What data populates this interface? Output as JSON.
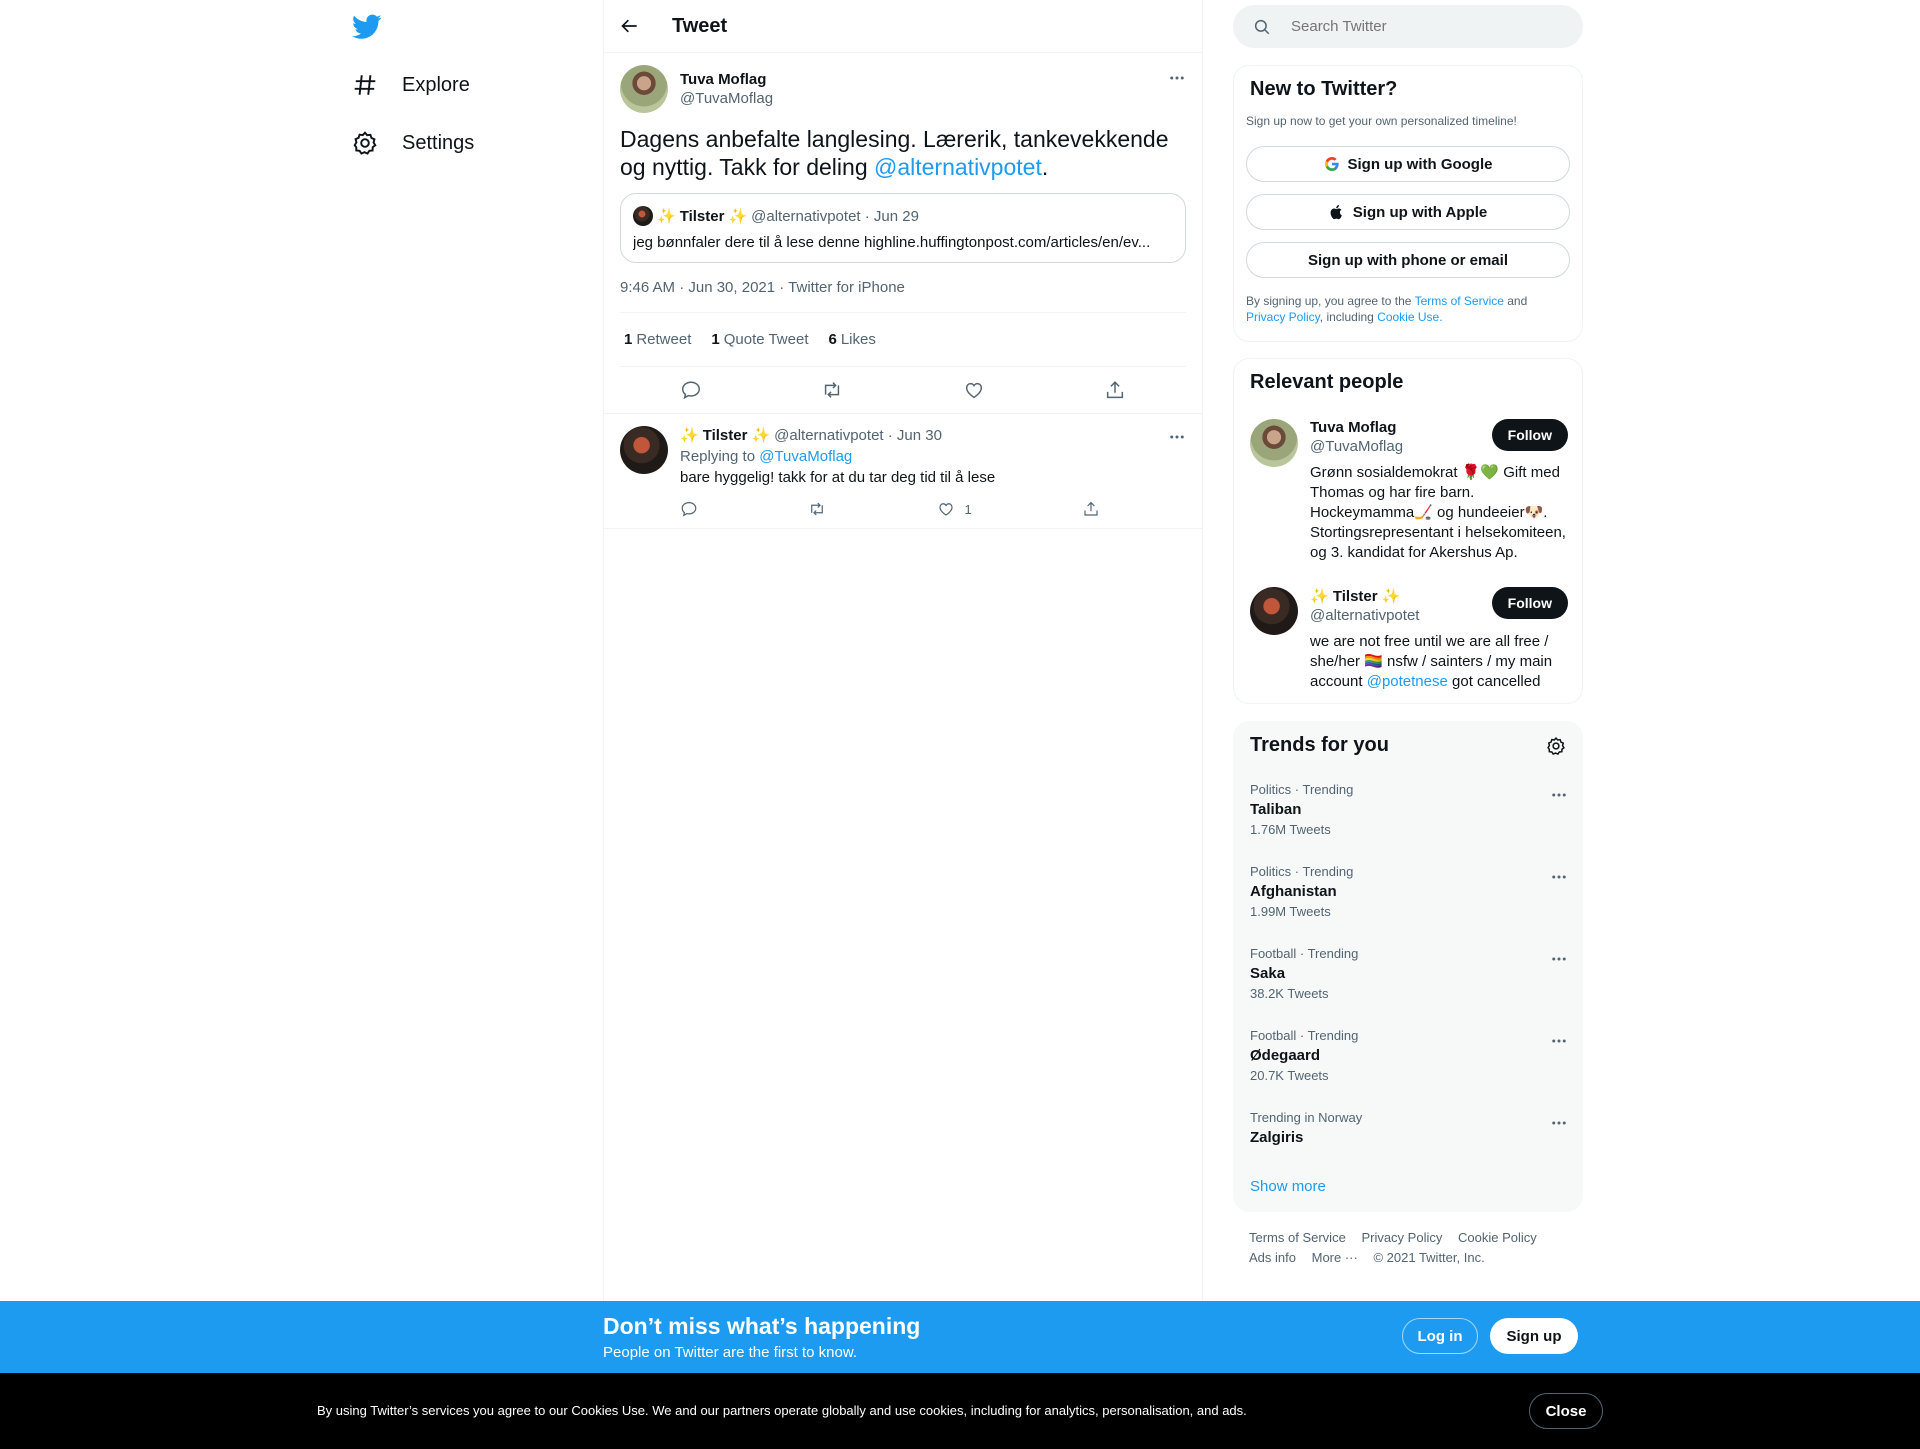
{
  "nav": {
    "explore_label": "Explore",
    "settings_label": "Settings"
  },
  "header": {
    "title": "Tweet"
  },
  "tweet": {
    "author_name": "Tuva Moflag",
    "author_handle": "@TuvaMoflag",
    "text_before": "Dagens anbefalte langlesing. Lærerik, tankevekkende og nyttig. Takk for deling ",
    "mention": "@alternativpotet",
    "text_after": ".",
    "quote": {
      "name_prefix": "✨",
      "name": "Tilster",
      "name_suffix": "✨",
      "handle_date": "@alternativpotet · Jun 29",
      "text": "jeg bønnfaler dere til å lese denne highline.huffingtonpost.com/articles/en/ev..."
    },
    "meta": "9:46 AM · Jun 30, 2021 · Twitter for iPhone",
    "stats": {
      "retweets": "1",
      "retweets_label": "Retweet",
      "quotes": "1",
      "quotes_label": "Quote Tweet",
      "likes": "6",
      "likes_label": "Likes"
    }
  },
  "reply": {
    "name_prefix": "✨",
    "name": "Tilster",
    "name_suffix": "✨",
    "handle_date": "@alternativpotet · Jun 30",
    "replying_label": "Replying to",
    "replying_to": "@TuvaMoflag",
    "text": "bare hyggelig! takk for at du tar deg tid til å lese",
    "like_count": "1"
  },
  "search": {
    "placeholder": "Search Twitter"
  },
  "new_to_twitter": {
    "title": "New to Twitter?",
    "subtitle": "Sign up now to get your own personalized timeline!",
    "google": "Sign up with Google",
    "apple": "Sign up with Apple",
    "phone": "Sign up with phone or email",
    "legal_1": "By signing up, you agree to the ",
    "tos": "Terms of Service",
    "legal_2": " and ",
    "privacy": "Privacy Policy",
    "legal_3": ", including ",
    "cookie": "Cookie Use."
  },
  "relevant": {
    "title": "Relevant people",
    "people": [
      {
        "name": "Tuva Moflag",
        "handle": "@TuvaMoflag",
        "bio": "Grønn sosialdemokrat 🌹💚 Gift med Thomas og har fire barn. Hockeymamma🏒 og hundeeier🐶. Stortingsrepresentant i helsekomiteen, og 3. kandidat for Akershus Ap.",
        "follow": "Follow"
      },
      {
        "name": "✨ Tilster ✨",
        "handle": "@alternativpotet",
        "bio_before": "we are not free until we are all free / she/her 🏳️‍🌈 nsfw / sainters / my main account ",
        "bio_mention": "@potetnese",
        "bio_after": " got cancelled",
        "follow": "Follow"
      }
    ]
  },
  "trends": {
    "title": "Trends for you",
    "items": [
      {
        "category": "Politics · Trending",
        "name": "Taliban",
        "count": "1.76M Tweets"
      },
      {
        "category": "Politics · Trending",
        "name": "Afghanistan",
        "count": "1.99M Tweets"
      },
      {
        "category": "Football · Trending",
        "name": "Saka",
        "count": "38.2K Tweets"
      },
      {
        "category": "Football · Trending",
        "name": "Ødegaard",
        "count": "20.7K Tweets"
      },
      {
        "category": "Trending in Norway",
        "name": "Zalgiris",
        "count": ""
      }
    ],
    "show_more": "Show more"
  },
  "footer": {
    "tos": "Terms of Service",
    "privacy": "Privacy Policy",
    "cookie": "Cookie Policy",
    "ads": "Ads info",
    "more": "More ···",
    "copyright": "© 2021 Twitter, Inc."
  },
  "banner": {
    "title": "Don’t miss what’s happening",
    "subtitle": "People on Twitter are the first to know.",
    "login": "Log in",
    "signup": "Sign up"
  },
  "cookie_bar": {
    "text": "By using Twitter’s services you agree to our Cookies Use. We and our partners operate globally and use cookies, including for analytics, personalisation, and ads.",
    "close": "Close"
  },
  "colors": {
    "accent": "#1d9bf0",
    "text": "#0f1419",
    "secondary": "#536471"
  }
}
